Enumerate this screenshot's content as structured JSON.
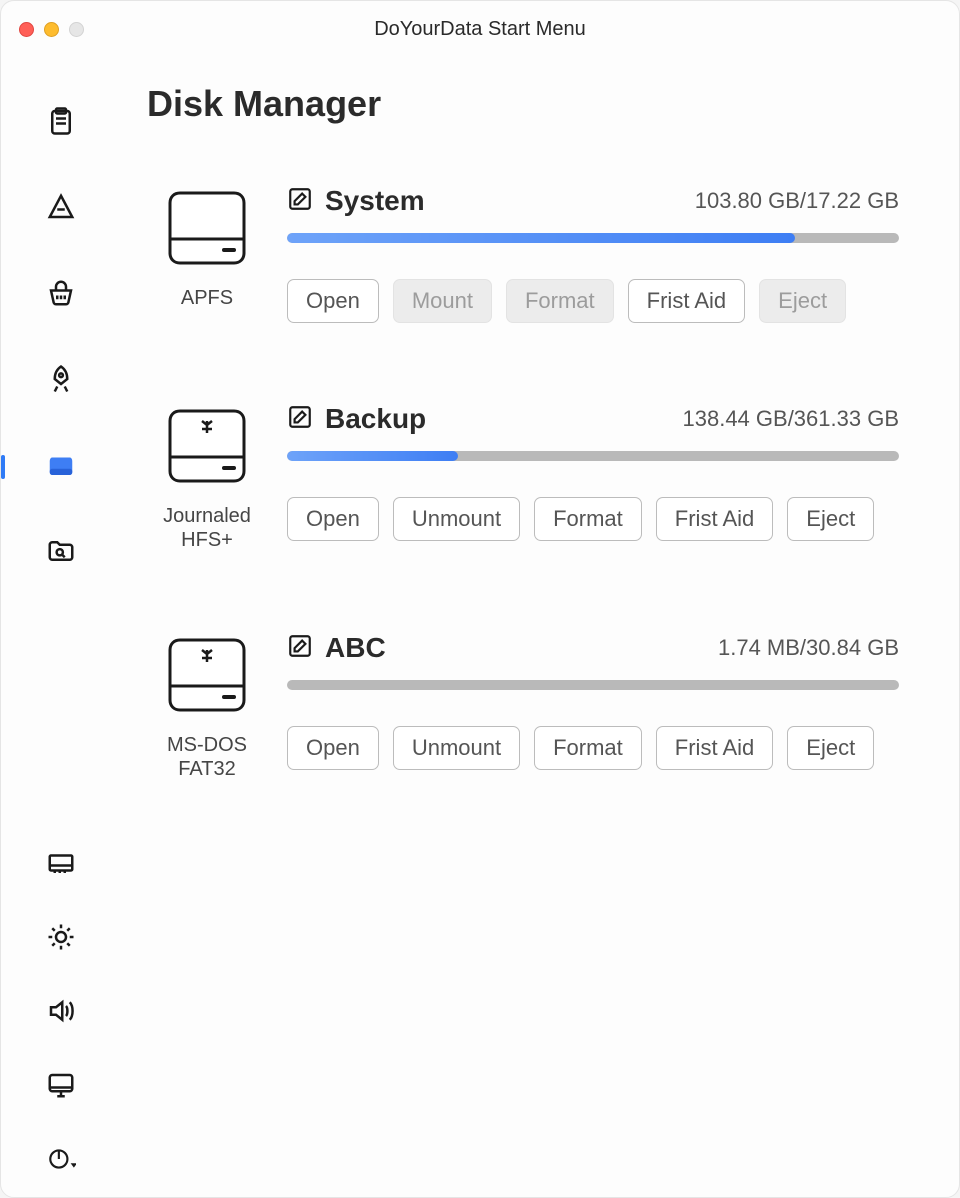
{
  "window": {
    "title": "DoYourData Start Menu"
  },
  "page": {
    "title": "Disk Manager"
  },
  "disks": [
    {
      "name": "System",
      "fs": "APFS",
      "used_label": "103.80 GB/17.22 GB",
      "progress_pct": 83,
      "internal": true,
      "actions": {
        "open": "Open",
        "mount": "Mount",
        "format": "Format",
        "firstaid": "Frist Aid",
        "eject": "Eject"
      },
      "enabled": {
        "open": true,
        "mount": false,
        "format": false,
        "firstaid": true,
        "eject": false
      }
    },
    {
      "name": "Backup",
      "fs": "Journaled HFS+",
      "used_label": "138.44 GB/361.33 GB",
      "progress_pct": 28,
      "internal": false,
      "actions": {
        "open": "Open",
        "mount": "Unmount",
        "format": "Format",
        "firstaid": "Frist Aid",
        "eject": "Eject"
      },
      "enabled": {
        "open": true,
        "mount": true,
        "format": true,
        "firstaid": true,
        "eject": true
      }
    },
    {
      "name": "ABC",
      "fs": "MS-DOS FAT32",
      "used_label": "1.74 MB/30.84 GB",
      "progress_pct": 0,
      "internal": false,
      "actions": {
        "open": "Open",
        "mount": "Unmount",
        "format": "Format",
        "firstaid": "Frist Aid",
        "eject": "Eject"
      },
      "enabled": {
        "open": true,
        "mount": true,
        "format": true,
        "firstaid": true,
        "eject": true
      }
    }
  ]
}
